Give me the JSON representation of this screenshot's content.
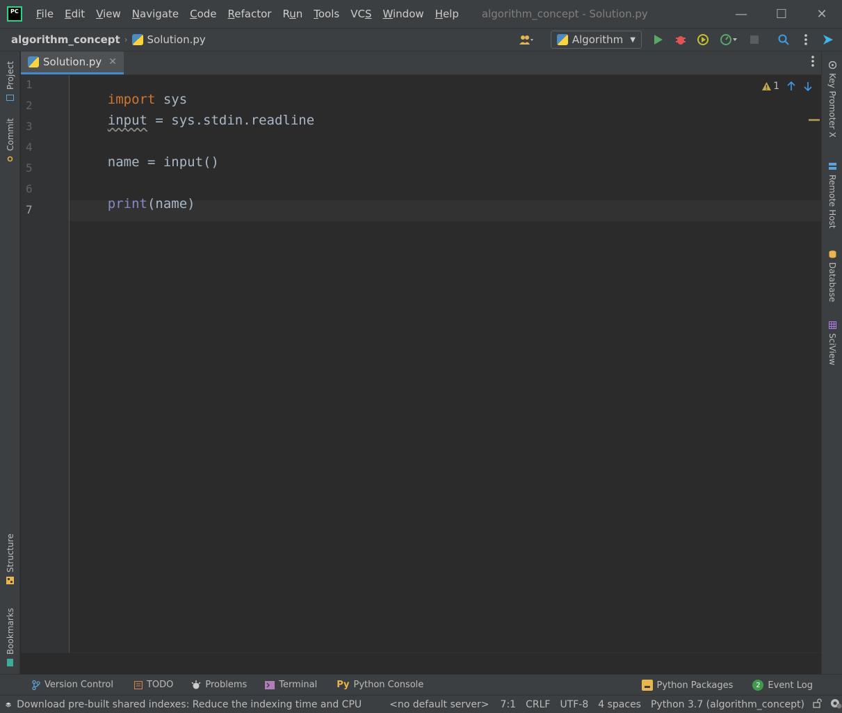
{
  "titlebar": {
    "logo_text": "PC",
    "menu": [
      {
        "pre": "",
        "u": "F",
        "post": "ile"
      },
      {
        "pre": "",
        "u": "E",
        "post": "dit"
      },
      {
        "pre": "",
        "u": "V",
        "post": "iew"
      },
      {
        "pre": "",
        "u": "N",
        "post": "avigate"
      },
      {
        "pre": "",
        "u": "C",
        "post": "ode"
      },
      {
        "pre": "",
        "u": "R",
        "post": "efactor"
      },
      {
        "pre": "R",
        "u": "u",
        "post": "n"
      },
      {
        "pre": "",
        "u": "T",
        "post": "ools"
      },
      {
        "pre": "VC",
        "u": "S",
        "post": ""
      },
      {
        "pre": "",
        "u": "W",
        "post": "indow"
      },
      {
        "pre": "",
        "u": "H",
        "post": "elp"
      }
    ],
    "window_title": "algorithm_concept - Solution.py",
    "minimize": "—",
    "maximize": "☐",
    "close": "✕"
  },
  "navbar": {
    "project": "algorithm_concept",
    "separator": "›",
    "file": "Solution.py",
    "run_config": "Algorithm",
    "run_config_caret": "▼"
  },
  "editor_tab": {
    "label": "Solution.py",
    "close": "✕"
  },
  "editor": {
    "line_numbers": [
      "1",
      "2",
      "3",
      "4",
      "5",
      "6",
      "7"
    ],
    "line1": {
      "kw": "import",
      "rest": " sys"
    },
    "line2": {
      "squiggle": "input",
      "rest": " = sys.stdin.readline"
    },
    "line4": {
      "pre": "name = ",
      "call": "input()"
    },
    "line6": {
      "fn": "print",
      "rest": "(name)"
    },
    "warning_count": "1"
  },
  "left_tools": {
    "project": "Project",
    "commit": "Commit",
    "structure": "Structure",
    "bookmarks": "Bookmarks"
  },
  "right_tools": {
    "key_promoter": "Key Promoter X",
    "remote_host": "Remote Host",
    "database": "Database",
    "sciview": "SciView"
  },
  "bottom_tools": {
    "version_control": "Version Control",
    "todo": "TODO",
    "problems": "Problems",
    "terminal": "Terminal",
    "python_console": "Python Console",
    "python_console_icon": "Py",
    "python_packages": "Python Packages",
    "event_log": "Event Log",
    "event_log_count": "2"
  },
  "status": {
    "message": "Download pre-built shared indexes: Reduce the indexing time and CPU",
    "server": "<no default server>",
    "position": "7:1",
    "line_sep": "CRLF",
    "encoding": "UTF-8",
    "indent": "4 spaces",
    "interpreter": "Python 3.7 (algorithm_concept)"
  },
  "colors": {
    "keyword": "#cc7832",
    "builtin": "#8888c6",
    "text": "#a9b7c6",
    "accent": "#4a88c7",
    "run_green": "#59a869",
    "debug_red": "#e05555"
  }
}
